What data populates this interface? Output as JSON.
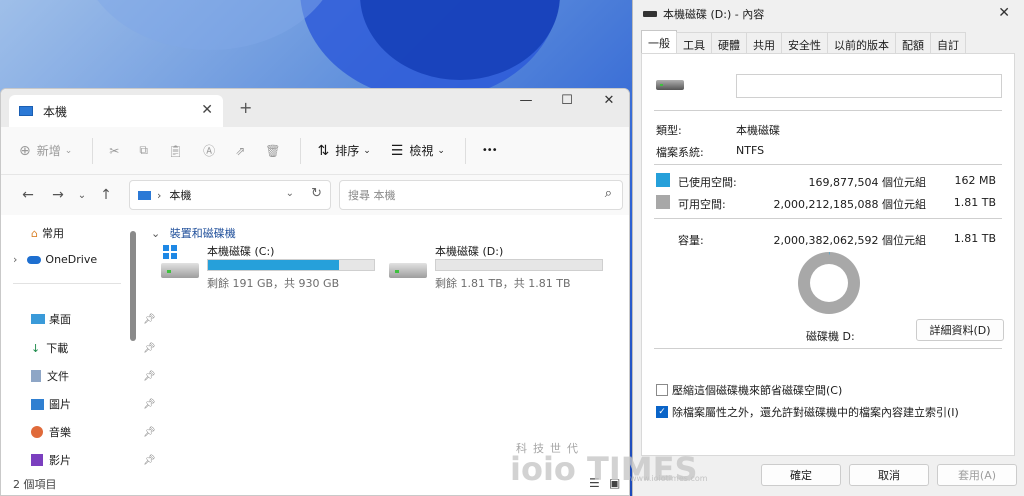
{
  "explorer": {
    "tab_title": "本機",
    "new_tab": "+",
    "close_tab": "✕",
    "window_controls": {
      "minimize": "—",
      "maximize": "☐",
      "close": "✕"
    },
    "toolbar": {
      "new_label": "新增",
      "sort_label": "排序",
      "view_label": "檢視",
      "more": "•••"
    },
    "nav": {
      "back": "←",
      "forward": "→",
      "recent": "⌄",
      "up": "↑"
    },
    "address": {
      "path": "本機",
      "separator": "›"
    },
    "search": {
      "placeholder": "搜尋 本機"
    },
    "sidebar": {
      "home": "常用",
      "onedrive": "OneDrive",
      "quick": [
        {
          "label": "桌面"
        },
        {
          "label": "下載"
        },
        {
          "label": "文件"
        },
        {
          "label": "圖片"
        },
        {
          "label": "音樂"
        },
        {
          "label": "影片"
        }
      ]
    },
    "group_header": "裝置和磁碟機",
    "drives": [
      {
        "name": "本機磁碟 (C:)",
        "free": "剩餘 191 GB，共 930 GB",
        "used_fraction": 0.79
      },
      {
        "name": "本機磁碟 (D:)",
        "free": "剩餘 1.81 TB，共 1.81 TB",
        "used_fraction": 0.0
      }
    ],
    "status": "2 個項目"
  },
  "properties": {
    "title": "本機磁碟 (D:) - 內容",
    "close": "✕",
    "tabs": [
      "一般",
      "工具",
      "硬體",
      "共用",
      "安全性",
      "以前的版本",
      "配額",
      "自訂"
    ],
    "type_key": "類型:",
    "type_val": "本機磁碟",
    "fs_key": "檔案系統:",
    "fs_val": "NTFS",
    "used_label": "已使用空間:",
    "used_bytes": "169,877,504 個位元組",
    "used_size": "162 MB",
    "free_label": "可用空間:",
    "free_bytes": "2,000,212,185,088 個位元組",
    "free_size": "1.81 TB",
    "cap_label": "容量:",
    "cap_bytes": "2,000,382,062,592 個位元組",
    "cap_size": "1.81 TB",
    "drive_label": "磁碟機 D:",
    "detail_button": "詳細資料(D)",
    "compress_label": "壓縮這個磁碟機來節省磁碟空間(C)",
    "compress_checked": false,
    "index_label": "除檔案屬性之外，還允許對磁碟機中的檔案內容建立索引(I)",
    "index_checked": true,
    "ok": "確定",
    "cancel": "取消",
    "apply": "套用(A)",
    "colors": {
      "used": "#26a0da",
      "free": "#a8a8a8"
    },
    "used_fraction": 0.0001
  },
  "watermark": {
    "small": "科技世代",
    "big": "ioio TIMES",
    "url": "www.ioiotimes.com"
  }
}
